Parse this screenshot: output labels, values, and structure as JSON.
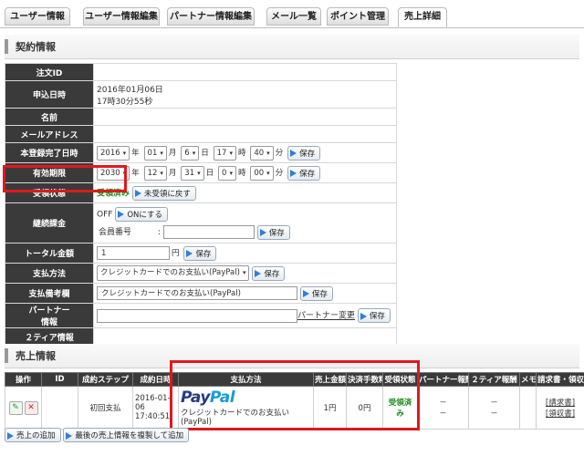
{
  "tabs": [
    {
      "label": "ユーザー情報"
    },
    {
      "label": "ユーザー情報編集"
    },
    {
      "label": "パートナー情報編集"
    },
    {
      "label": "メール一覧"
    },
    {
      "label": "ポイント管理"
    },
    {
      "label": "売上詳細"
    }
  ],
  "contract": {
    "title": "契約情報",
    "order_id_label": "注文ID",
    "applied_label": "申込日時",
    "applied_date": "2016年01月06日",
    "applied_time": "17時30分55秒",
    "name_label": "名前",
    "mail_label": "メールアドレス",
    "reg_label": "本登録完了日時",
    "reg": {
      "year": "2016",
      "month": "01",
      "day": "6",
      "hour": "17",
      "min": "40"
    },
    "valid_label": "有効期限",
    "valid": {
      "year": "2030",
      "month": "12",
      "day": "31",
      "hour": "0",
      "min": "00"
    },
    "u_year": "年",
    "u_month": "月",
    "u_day": "日",
    "u_hour": "時",
    "u_min": "分",
    "save": "保存",
    "recv_label": "受領状態",
    "recv_status": "受領済み",
    "recv_btn": "未受領に戻す",
    "cont_label": "継続課金",
    "cont_status": "OFF",
    "cont_btn": "ONにする",
    "member_no_label": "会員番号",
    "member_colon": ":",
    "total_label": "トータル金額",
    "total_value": "1",
    "yen": "円",
    "pay_label": "支払方法",
    "pay_value": "クレジットカードでのお支払い(PayPal)",
    "pay_note_label": "支払備考欄",
    "pay_note_value": "クレジットカードでのお支払い(PayPal)",
    "partner_label_1": "パートナー",
    "partner_label_2": "情報",
    "partner_change": "パートナー変更",
    "tier2_label": "２ティア情報"
  },
  "sales": {
    "title": "売上情報",
    "headers": [
      "操作",
      "ID",
      "成約ステップ",
      "成約日時",
      "支払方法",
      "売上金額",
      "決済手数料",
      "受領状態",
      "パートナー報酬",
      "２ティア報酬",
      "メモ",
      "請求書・領収書"
    ],
    "row": {
      "step": "初回支払",
      "date": "2016-01-06",
      "time": "17:40:51",
      "paypal_logo_a": "Pay",
      "paypal_logo_b": "Pal",
      "pay_method": "クレジットカードでのお支払い(PayPal)",
      "amount": "1円",
      "fee": "0円",
      "status": "受領済み",
      "dash": "－",
      "invoice": "[請求書]",
      "receipt": "[領収書]"
    },
    "add_btn": "売上の追加",
    "copy_btn": "最後の売上情報を複製して追加"
  },
  "colors": {
    "accent": "#2f7fd8",
    "highlight": "#e0181e",
    "header_bg": "#3a3a3a",
    "success": "#1a8a1a",
    "paypal_dark": "#253b80",
    "paypal_light": "#179bd7"
  }
}
